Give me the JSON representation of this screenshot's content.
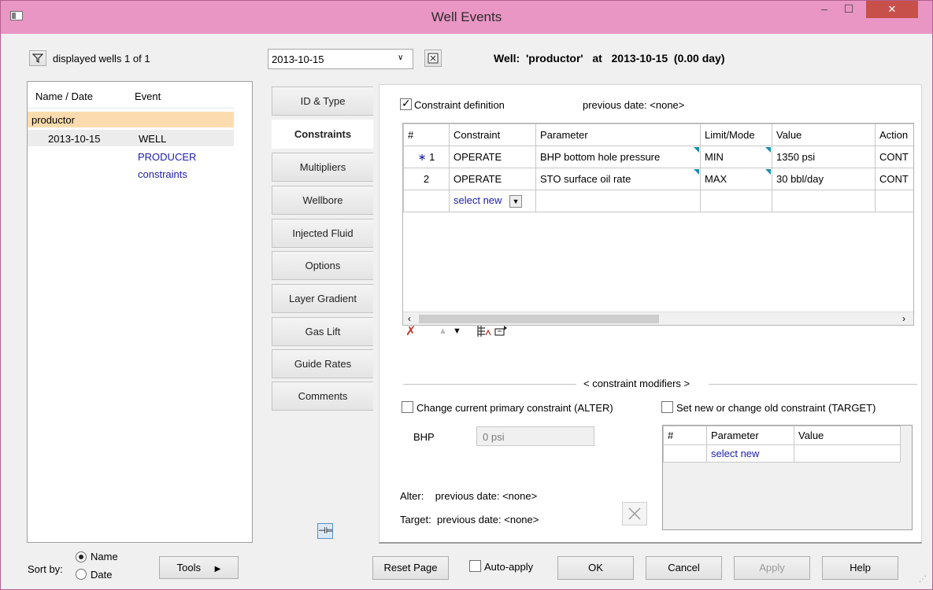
{
  "window": {
    "title": "Well Events"
  },
  "left_panel": {
    "displayed_wells": "displayed wells 1 of 1",
    "columns": [
      "Name / Date",
      "Event"
    ],
    "well_name": "productor",
    "rows": [
      {
        "date": "2013-10-15",
        "event": "WELL"
      },
      {
        "date": "",
        "event": "PRODUCER"
      },
      {
        "date": "",
        "event": "constraints"
      }
    ],
    "sort_label": "Sort by:",
    "sort_options": [
      "Name",
      "Date"
    ],
    "tools_label": "Tools"
  },
  "header": {
    "date_selected": "2013-10-15",
    "well_caption": "Well:  'productor'   at   2013-10-15  (0.00 day)"
  },
  "tabs": [
    "ID & Type",
    "Constraints",
    "Multipliers",
    "Wellbore",
    "Injected Fluid",
    "Options",
    "Layer Gradient",
    "Gas Lift",
    "Guide Rates",
    "Comments"
  ],
  "constraints": {
    "checkbox_label": "Constraint definition",
    "previous_date": "previous date: <none>",
    "columns": [
      "#",
      "Constraint",
      "Parameter",
      "Limit/Mode",
      "Value",
      "Action"
    ],
    "rows": [
      {
        "num": "1",
        "constraint": "OPERATE",
        "parameter": "BHP bottom hole pressure",
        "limit": "MIN",
        "value": "1350  psi",
        "action": "CONT"
      },
      {
        "num": "2",
        "constraint": "OPERATE",
        "parameter": "STO surface oil rate",
        "limit": "MAX",
        "value": "30  bbl/day",
        "action": "CONT"
      }
    ],
    "select_new": "select new"
  },
  "modifiers": {
    "legend": "< constraint modifiers >",
    "alter_label": "Change current primary constraint (ALTER)",
    "target_label": "Set new or change old constraint (TARGET)",
    "bhp_label": "BHP",
    "bhp_value": "0  psi",
    "columns": [
      "#",
      "Parameter",
      "Value"
    ],
    "select_new": "select new",
    "alter_text": "Alter:    previous date: <none>",
    "target_text": "Target:  previous date: <none>"
  },
  "footer": {
    "reset": "Reset Page",
    "auto_apply": "Auto-apply",
    "ok": "OK",
    "cancel": "Cancel",
    "apply": "Apply",
    "help": "Help"
  },
  "colors": {
    "titlebar": "#e996c4",
    "selected_row": "#fcdcae",
    "link": "#1c1cae",
    "triangle": "#1b8ca8"
  }
}
